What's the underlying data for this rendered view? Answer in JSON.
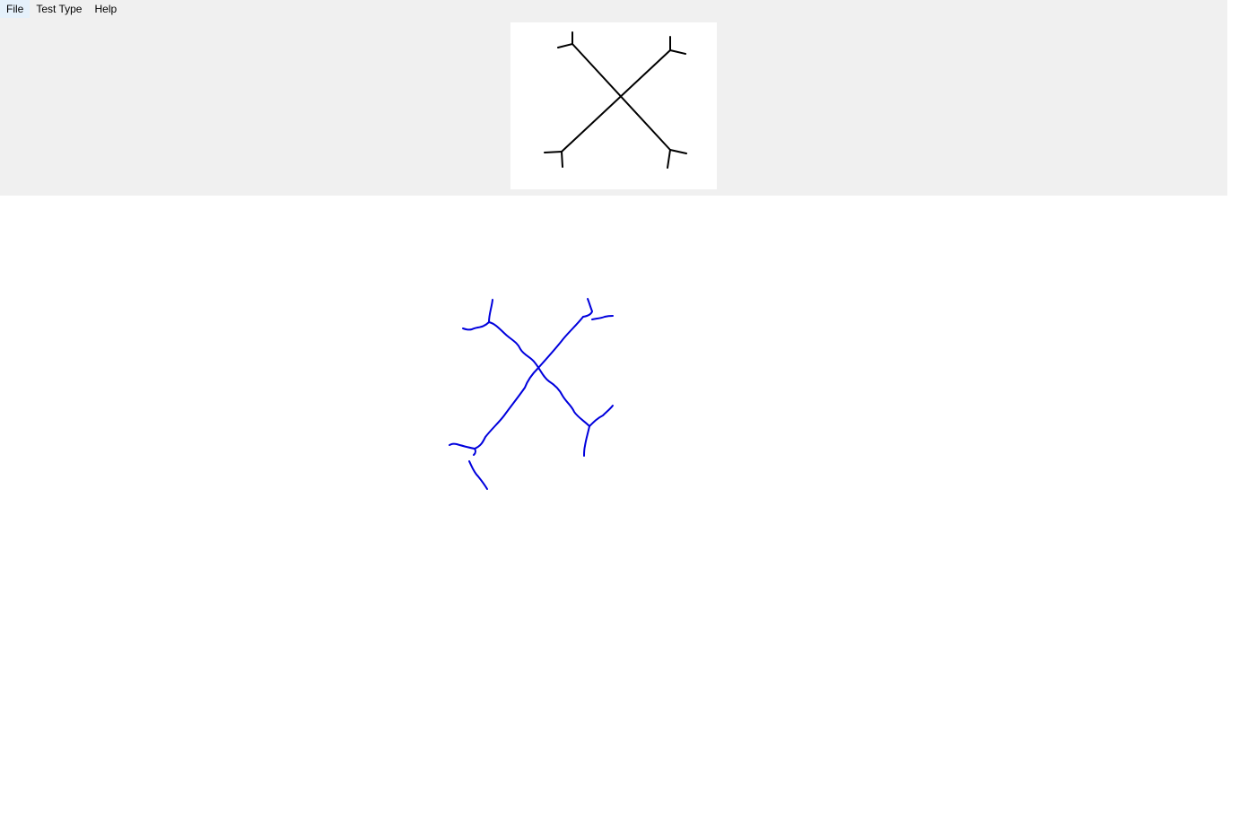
{
  "menu": {
    "file": "File",
    "test_type": "Test Type",
    "help": "Help"
  },
  "reference_figure": {
    "shape": "X with forked ends",
    "stroke_color": "#000000"
  },
  "drawing": {
    "stroke_color": "#0000dd"
  }
}
